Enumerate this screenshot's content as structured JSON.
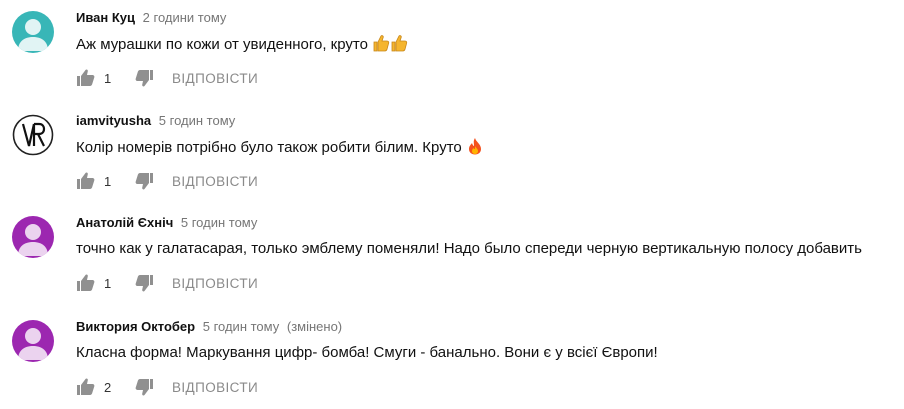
{
  "reply_label": "ВІДПОВІСТИ",
  "colors": {
    "text": "#111111",
    "meta": "#767676",
    "action": "#8a8a8a",
    "icon": "#909090",
    "avatar_teal": "#38b6b7",
    "avatar_purple": "#9c27b0"
  },
  "comments": [
    {
      "author": "Иван Куц",
      "time": "2 години тому",
      "edited": "",
      "text": "Аж мурашки по кожи от увиденного, круто",
      "emoji": "👍👍",
      "likes": "1",
      "avatar": "default-avatar-teal"
    },
    {
      "author": "iamvityusha",
      "time": "5 годин тому",
      "edited": "",
      "text": "Колір номерів потрібно було також робити білим. Круто",
      "emoji": "🔥",
      "likes": "1",
      "avatar": "vr-monogram-avatar"
    },
    {
      "author": "Анатолій Єхніч",
      "time": "5 годин тому",
      "edited": "",
      "text": "точно как у галатасарая, только эмблему поменяли! Надо было спереди черную вертикальную полосу добавить",
      "emoji": "",
      "likes": "1",
      "avatar": "default-avatar-purple"
    },
    {
      "author": "Виктория Октобер",
      "time": "5 годин тому",
      "edited": "(змінено)",
      "text": "Класна форма! Маркування цифр- бомба! Смуги - банально. Вони є у всієї Європи!",
      "emoji": "",
      "likes": "2",
      "avatar": "default-avatar-purple"
    }
  ]
}
